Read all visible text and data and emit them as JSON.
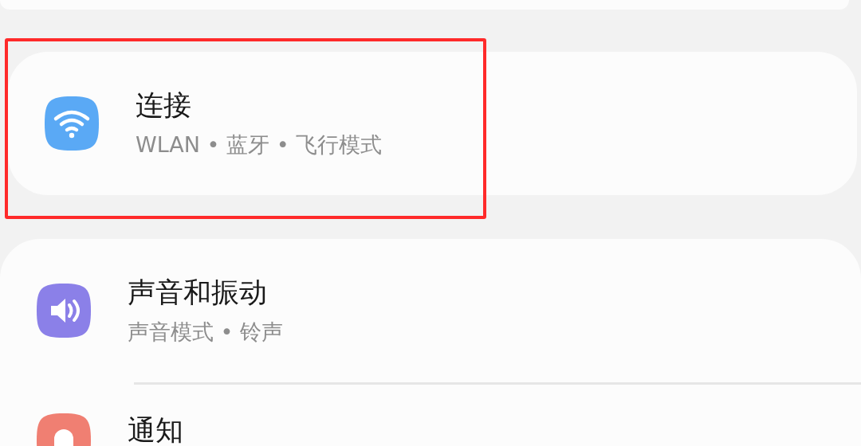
{
  "groups": [
    {
      "items": [
        {
          "kind": "connections",
          "color": "#5aa9f5",
          "title": "连接",
          "subtitle": "WLAN • 蓝牙 • 飞行模式",
          "highlighted": true
        }
      ]
    },
    {
      "items": [
        {
          "kind": "sound",
          "color": "#8b80e8",
          "title": "声音和振动",
          "subtitle": "声音模式 • 铃声",
          "highlighted": false
        },
        {
          "kind": "notifications",
          "color": "#f07f72",
          "title": "通知",
          "highlighted": false
        }
      ]
    }
  ]
}
